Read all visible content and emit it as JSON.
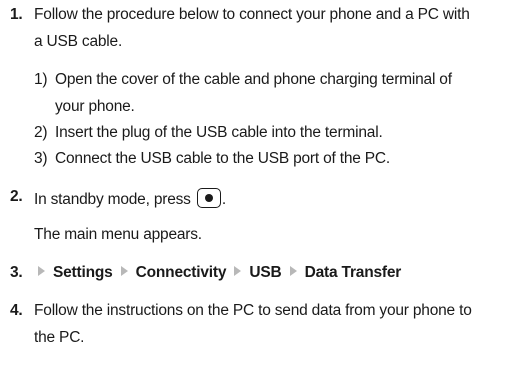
{
  "steps": [
    {
      "number": "1.",
      "text_line1": "Follow the procedure below to connect your phone and a PC with",
      "text_line2": "a USB cable.",
      "substeps": [
        {
          "number": "1)",
          "line1": "Open the cover of the cable and phone charging terminal of",
          "line2": "your phone."
        },
        {
          "number": "2)",
          "line1": "Insert the plug of the USB cable into the terminal."
        },
        {
          "number": "3)",
          "line1": "Connect the USB cable to the USB port of the PC."
        }
      ]
    },
    {
      "number": "2.",
      "text_before_key": "In standby mode, press",
      "text_after_key": ".",
      "key_icon": "center-select-key-icon",
      "note": "The main menu appears."
    },
    {
      "number": "3.",
      "menu_path": [
        "Settings",
        "Connectivity",
        "USB",
        "Data Transfer"
      ]
    },
    {
      "number": "4.",
      "text_line1": "Follow the instructions on the PC to send data from your phone to",
      "text_line2": "the PC."
    }
  ]
}
